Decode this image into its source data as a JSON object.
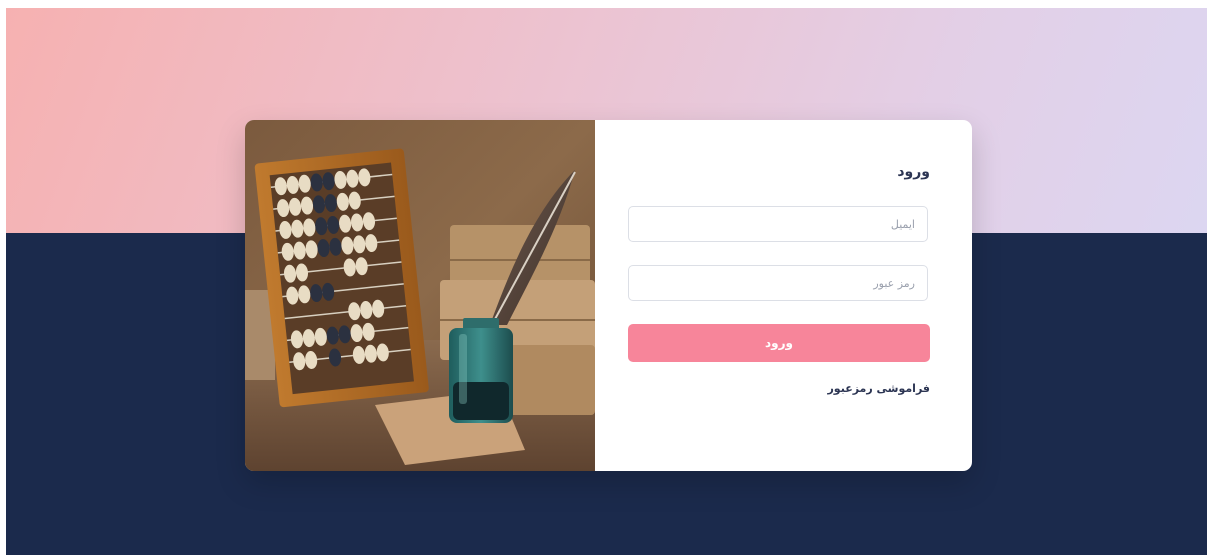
{
  "login": {
    "title": "ورود",
    "email_placeholder": "ایمیل",
    "password_placeholder": "رمز عبور",
    "submit_label": "ورود",
    "forgot_password_label": "فراموشی رمزعبور"
  },
  "colors": {
    "background_dark": "#1b2a4c",
    "hero_gradient_start": "#f6b1b1",
    "hero_gradient_end": "#dcd6f1",
    "accent_button": "#f7859a",
    "text_dark": "#2c3553"
  },
  "image": {
    "subject": "abacus-quill-inkwell-photo"
  }
}
